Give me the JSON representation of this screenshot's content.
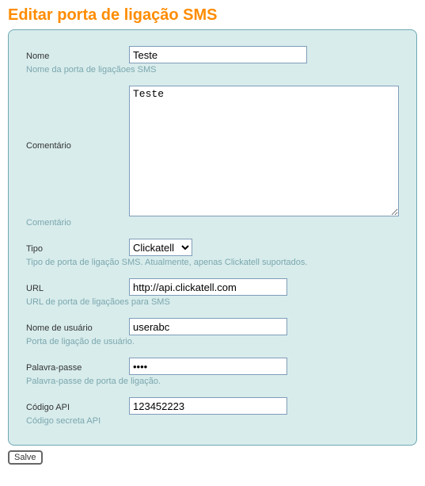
{
  "page": {
    "title": "Editar porta de ligação SMS"
  },
  "fields": {
    "name": {
      "label": "Nome",
      "value": "Teste",
      "hint": "Nome da porta de ligaçãoes SMS"
    },
    "comment": {
      "label": "Comentário",
      "value": "Teste",
      "hint": "Comentário"
    },
    "type": {
      "label": "Tipo",
      "selected": "Clickatell",
      "hint": "Tipo de porta de ligação SMS. Atualmente, apenas Clickatell suportados."
    },
    "url": {
      "label": "URL",
      "value": "http://api.clickatell.com",
      "hint": "URL de porta de ligaçãoes para SMS"
    },
    "username": {
      "label": "Nome de usuário",
      "value": "userabc",
      "hint": "Porta de ligação de usuário."
    },
    "password": {
      "label": "Palavra-passe",
      "value": "••••",
      "hint": "Palavra-passe de porta de ligação."
    },
    "api": {
      "label": "Código API",
      "value": "123452223",
      "hint": "Código secreta API"
    }
  },
  "actions": {
    "save": "Salve"
  }
}
